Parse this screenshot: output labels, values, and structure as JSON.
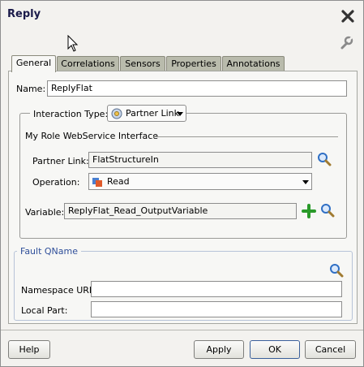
{
  "dialog": {
    "title": "Reply"
  },
  "tabs": [
    {
      "label": "General",
      "active": true
    },
    {
      "label": "Correlations",
      "active": false
    },
    {
      "label": "Sensors",
      "active": false
    },
    {
      "label": "Properties",
      "active": false
    },
    {
      "label": "Annotations",
      "active": false
    }
  ],
  "general": {
    "name_label": "Name:",
    "name_value": "ReplyFlat",
    "interaction_type_label": "Interaction Type:",
    "interaction_type_value": "Partner Link",
    "interface_section_label": "My Role WebService Interface",
    "partner_link_label": "Partner Link:",
    "partner_link_value": "FlatStructureIn",
    "operation_label": "Operation:",
    "operation_value": "Read",
    "variable_label": "Variable:",
    "variable_value": "ReplyFlat_Read_OutputVariable"
  },
  "fault": {
    "section_label": "Fault QName",
    "namespace_label": "Namespace URI:",
    "namespace_value": "",
    "local_part_label": "Local Part:",
    "local_part_value": ""
  },
  "buttons": {
    "help": "Help",
    "apply": "Apply",
    "ok": "OK",
    "cancel": "Cancel"
  },
  "icons": {
    "close": "close-icon",
    "settings": "wrench-icon",
    "search": "magnifier-icon",
    "add": "plus-icon",
    "partner_link": "gear-globe-icon",
    "operation": "operation-icon"
  },
  "colors": {
    "title": "#1b1b4a",
    "fault_title": "#2f4f9a",
    "add_icon": "#2a9a2a",
    "search_icon": "#2f6fc4"
  }
}
